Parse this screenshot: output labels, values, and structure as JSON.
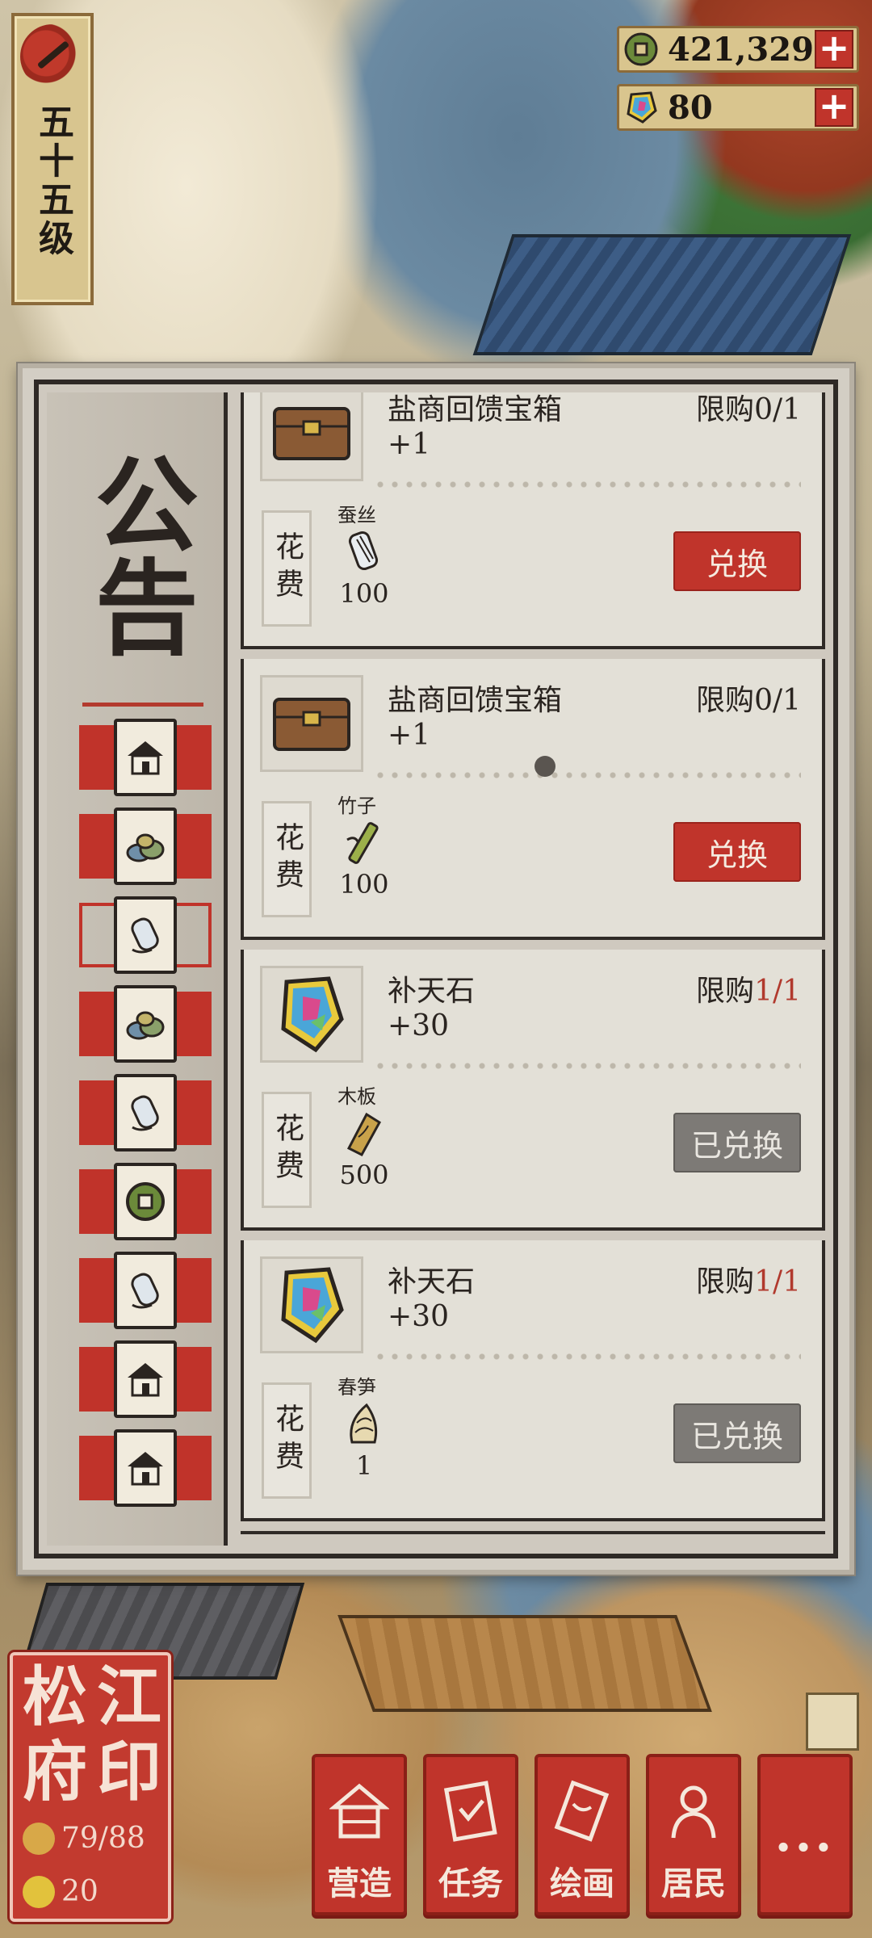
{
  "level": {
    "text": "五十五级"
  },
  "currencies": [
    {
      "icon": "copper-coin-icon",
      "value": "421,329",
      "plus": "+"
    },
    {
      "icon": "rainbow-stone-icon",
      "value": "80",
      "plus": "+"
    }
  ],
  "panel": {
    "title": "公告",
    "tabs": [
      {
        "icon": "house-icon",
        "active": false
      },
      {
        "icon": "ore-pile-icon",
        "active": false
      },
      {
        "icon": "silk-spool-icon",
        "active": true
      },
      {
        "icon": "ore-pile-icon",
        "active": false
      },
      {
        "icon": "silk-spool-icon",
        "active": false
      },
      {
        "icon": "copper-coin-icon",
        "active": false
      },
      {
        "icon": "silk-spool-icon",
        "active": false
      },
      {
        "icon": "house-icon",
        "active": false
      },
      {
        "icon": "house-icon",
        "active": false
      }
    ],
    "cost_label": "花费",
    "items": [
      {
        "name": "盐商回馈宝箱",
        "qty": "+1",
        "limit_prefix": "限购",
        "limit_count": "0/1",
        "limit_reached": false,
        "icon": "treasure-chest-icon",
        "material": "蚕丝",
        "material_icon": "silk-spool-icon",
        "amount": "100",
        "button": "兑换",
        "redeemed": false
      },
      {
        "name": "盐商回馈宝箱",
        "qty": "+1",
        "limit_prefix": "限购",
        "limit_count": "0/1",
        "limit_reached": false,
        "icon": "treasure-chest-icon",
        "material": "竹子",
        "material_icon": "bamboo-icon",
        "amount": "100",
        "button": "兑换",
        "redeemed": false
      },
      {
        "name": "补天石",
        "qty": "+30",
        "limit_prefix": "限购",
        "limit_count": "1/1",
        "limit_reached": true,
        "icon": "rainbow-stone-icon",
        "material": "木板",
        "material_icon": "wood-plank-icon",
        "amount": "500",
        "button": "已兑换",
        "redeemed": true
      },
      {
        "name": "补天石",
        "qty": "+30",
        "limit_prefix": "限购",
        "limit_count": "1/1",
        "limit_reached": true,
        "icon": "rainbow-stone-icon",
        "material": "春笋",
        "material_icon": "bamboo-shoot-icon",
        "amount": "1",
        "button": "已兑换",
        "redeemed": true
      }
    ]
  },
  "seal": {
    "title_chars": [
      "松",
      "江",
      "府",
      "印"
    ],
    "population": "79/88",
    "coins": "20"
  },
  "nav": [
    {
      "label": "营造",
      "icon": "construction-icon"
    },
    {
      "label": "任务",
      "icon": "task-book-icon"
    },
    {
      "label": "绘画",
      "icon": "painting-scroll-icon"
    },
    {
      "label": "居民",
      "icon": "resident-icon"
    },
    {
      "label": "...",
      "icon": "more-icon"
    }
  ],
  "colors": {
    "accent_red": "#c0342b",
    "redeemed_gray": "#7d7a76",
    "paper": "#e3e0d7",
    "ink": "#2a2420"
  }
}
